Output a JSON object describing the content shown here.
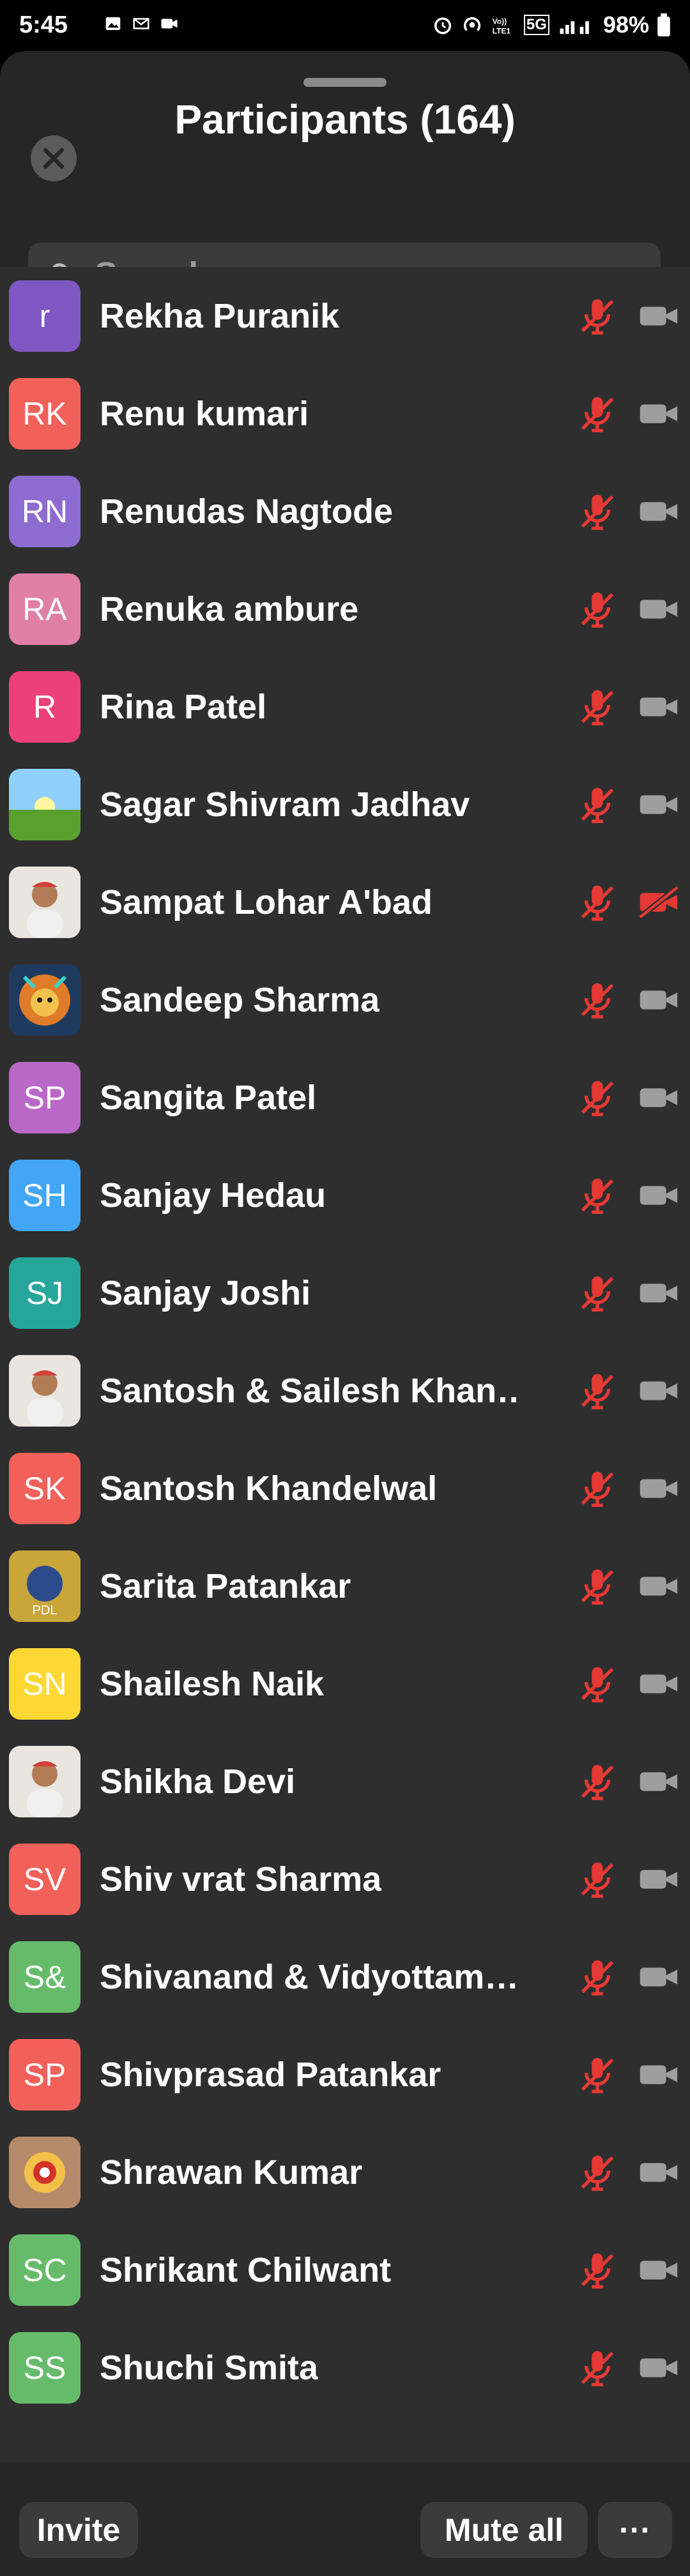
{
  "status_bar": {
    "time": "5:45",
    "battery": "98%",
    "network": "5G"
  },
  "header": {
    "title": "Participants (164)"
  },
  "search": {
    "placeholder": "Search"
  },
  "participants": [
    {
      "name": "Rekha Puranik",
      "initials": "r",
      "color": "#7e57c2",
      "mic": "muted",
      "cam": "on"
    },
    {
      "name": "Renu kumari",
      "initials": "RK",
      "color": "#f2605a",
      "mic": "muted",
      "cam": "on"
    },
    {
      "name": "Renudas Nagtode",
      "initials": "RN",
      "color": "#8e6bd1",
      "mic": "muted",
      "cam": "on"
    },
    {
      "name": "Renuka ambure",
      "initials": "RA",
      "color": "#e07fa6",
      "mic": "muted",
      "cam": "on"
    },
    {
      "name": "Rina Patel",
      "initials": "R",
      "color": "#ec407a",
      "mic": "muted",
      "cam": "on"
    },
    {
      "name": "Sagar Shivram Jadhav",
      "initials": "",
      "color": "#6aa84f",
      "photo": "landscape",
      "mic": "muted",
      "cam": "on"
    },
    {
      "name": "Sampat Lohar A'bad",
      "initials": "",
      "color": "#d9d4cc",
      "photo": "person",
      "mic": "muted",
      "cam": "off"
    },
    {
      "name": "Sandeep Sharma",
      "initials": "",
      "color": "#1e3a5f",
      "photo": "lion",
      "mic": "muted",
      "cam": "on"
    },
    {
      "name": "Sangita Patel",
      "initials": "SP",
      "color": "#ba68c8",
      "mic": "muted",
      "cam": "on"
    },
    {
      "name": "Sanjay Hedau",
      "initials": "SH",
      "color": "#42a5f5",
      "mic": "muted",
      "cam": "on"
    },
    {
      "name": "Sanjay Joshi",
      "initials": "SJ",
      "color": "#26a69a",
      "mic": "muted",
      "cam": "on"
    },
    {
      "name": "Santosh & Sailesh Khan…",
      "initials": "",
      "color": "#e0e0e0",
      "photo": "person",
      "mic": "muted",
      "cam": "on"
    },
    {
      "name": "Santosh Khandelwal",
      "initials": "SK",
      "color": "#f2605a",
      "mic": "muted",
      "cam": "on"
    },
    {
      "name": "Sarita  Patankar",
      "initials": "",
      "color": "#d4b84a",
      "photo": "logo",
      "mic": "muted",
      "cam": "on"
    },
    {
      "name": "Shailesh Naik",
      "initials": "SN",
      "color": "#fdd835",
      "mic": "muted",
      "cam": "on"
    },
    {
      "name": "Shikha Devi",
      "initials": "",
      "color": "#e8e8e8",
      "photo": "person",
      "mic": "muted",
      "cam": "on"
    },
    {
      "name": "Shiv vrat Sharma",
      "initials": "SV",
      "color": "#f2605a",
      "mic": "muted",
      "cam": "on"
    },
    {
      "name": "Shivanand & Vidyottam…",
      "initials": "S&",
      "color": "#66bb6a",
      "mic": "muted",
      "cam": "on"
    },
    {
      "name": "Shivprasad Patankar",
      "initials": "SP",
      "color": "#f2605a",
      "mic": "muted",
      "cam": "on"
    },
    {
      "name": "Shrawan Kumar",
      "initials": "",
      "color": "#b58a6a",
      "photo": "flowers",
      "mic": "muted",
      "cam": "on"
    },
    {
      "name": "Shrikant Chilwant",
      "initials": "SC",
      "color": "#66bb6a",
      "mic": "muted",
      "cam": "on"
    },
    {
      "name": "Shuchi Smita",
      "initials": "SS",
      "color": "#66bb6a",
      "mic": "muted",
      "cam": "on"
    }
  ],
  "footer": {
    "invite_label": "Invite",
    "mute_all_label": "Mute all",
    "more_label": "···"
  },
  "colors": {
    "muted_red": "#e53935",
    "cam_gray": "#9e9e9e",
    "sheet_bg": "#262626",
    "list_bg": "#2e2e2e"
  }
}
